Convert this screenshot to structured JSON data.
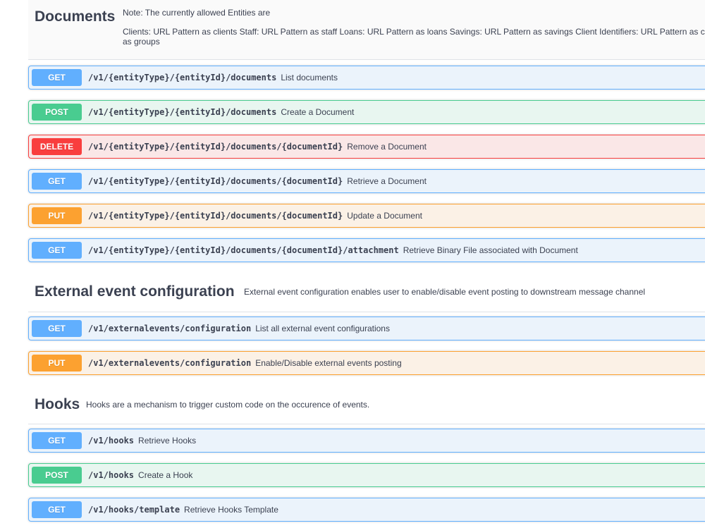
{
  "documents": {
    "title": "Documents",
    "note": "Note: The currently allowed Entities are",
    "entities": "Clients: URL Pattern as clients Staff: URL Pattern as staff Loans: URL Pattern as loans Savings: URL Pattern as savings Client Identifiers: URL Pattern as client_identifiers Groups: URL Pattern",
    "entities_line2": "as groups",
    "ops": [
      {
        "method": "GET",
        "path": "/v1/{entityType}/{entityId}/documents",
        "summary": "List documents"
      },
      {
        "method": "POST",
        "path": "/v1/{entityType}/{entityId}/documents",
        "summary": "Create a Document"
      },
      {
        "method": "DELETE",
        "path": "/v1/{entityType}/{entityId}/documents/{documentId}",
        "summary": "Remove a Document"
      },
      {
        "method": "GET",
        "path": "/v1/{entityType}/{entityId}/documents/{documentId}",
        "summary": "Retrieve a Document"
      },
      {
        "method": "PUT",
        "path": "/v1/{entityType}/{entityId}/documents/{documentId}",
        "summary": "Update a Document"
      },
      {
        "method": "GET",
        "path": "/v1/{entityType}/{entityId}/documents/{documentId}/attachment",
        "summary": "Retrieve Binary File associated with Document"
      }
    ]
  },
  "external": {
    "title": "External event configuration",
    "desc": "External event configuration enables user to enable/disable event posting to downstream message channel",
    "ops": [
      {
        "method": "GET",
        "path": "/v1/externalevents/configuration",
        "summary": "List all external event configurations"
      },
      {
        "method": "PUT",
        "path": "/v1/externalevents/configuration",
        "summary": "Enable/Disable external events posting"
      }
    ]
  },
  "hooks": {
    "title": "Hooks",
    "desc": "Hooks are a mechanism to trigger custom code on the occurence of events.",
    "ops": [
      {
        "method": "GET",
        "path": "/v1/hooks",
        "summary": "Retrieve Hooks"
      },
      {
        "method": "POST",
        "path": "/v1/hooks",
        "summary": "Create a Hook"
      },
      {
        "method": "GET",
        "path": "/v1/hooks/template",
        "summary": "Retrieve Hooks Template"
      }
    ]
  },
  "colors": {
    "get": "#61affe",
    "post": "#49cc90",
    "put": "#fca130",
    "delete": "#f93e3e"
  }
}
